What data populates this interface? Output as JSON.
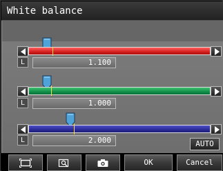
{
  "window": {
    "title": "White balance"
  },
  "channels": [
    {
      "name": "red",
      "label_prefix": "L",
      "value": "1.100",
      "level": 1.1
    },
    {
      "name": "green",
      "label_prefix": "L",
      "value": "1.000",
      "level": 1.0
    },
    {
      "name": "blue",
      "label_prefix": "L",
      "value": "2.000",
      "level": 2.0
    }
  ],
  "auto_button": {
    "label": "AUTO"
  },
  "toolbar": {
    "icons": [
      "screen-frame-icon",
      "zoom-icon",
      "camera-icon"
    ],
    "ok_label": "OK",
    "cancel_label": "Cancel"
  },
  "colors": {
    "red": "#d42020",
    "green": "#11904a",
    "blue": "#2a2a98",
    "thumb": "#4fa3d8",
    "tick": "#ffe040"
  }
}
